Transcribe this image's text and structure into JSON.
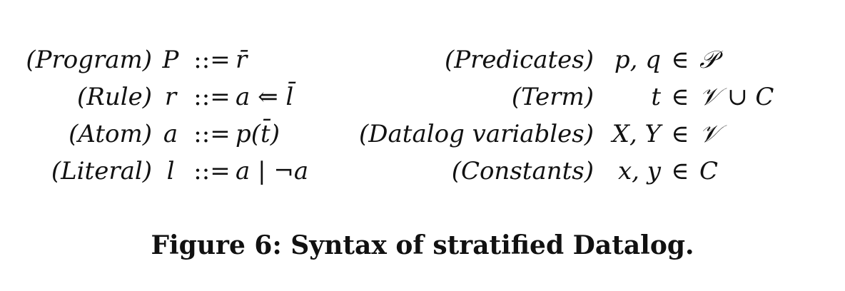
{
  "grammar": {
    "left": [
      {
        "name": "(Program)",
        "symbol": "P",
        "def": "::=",
        "rhs": "r̄"
      },
      {
        "name": "(Rule)",
        "symbol": "r",
        "def": "::=",
        "rhs": "a ⇐ l̄"
      },
      {
        "name": "(Atom)",
        "symbol": "a",
        "def": "::=",
        "rhs": "p(t̄)"
      },
      {
        "name": "(Literal)",
        "symbol": "l",
        "def": "::=",
        "rhs": "a | ¬a"
      }
    ],
    "right": [
      {
        "name": "(Predicates)",
        "symbol": "p, q",
        "in": "∈",
        "set": "𝒫"
      },
      {
        "name": "(Term)",
        "symbol": "t",
        "in": "∈",
        "set": "𝒱 ∪ C"
      },
      {
        "name": "(Datalog variables)",
        "symbol": "X, Y",
        "in": "∈",
        "set": "𝒱"
      },
      {
        "name": "(Constants)",
        "symbol": "x, y",
        "in": "∈",
        "set": "C"
      }
    ]
  },
  "caption": "Figure 6: Syntax of stratified Datalog."
}
